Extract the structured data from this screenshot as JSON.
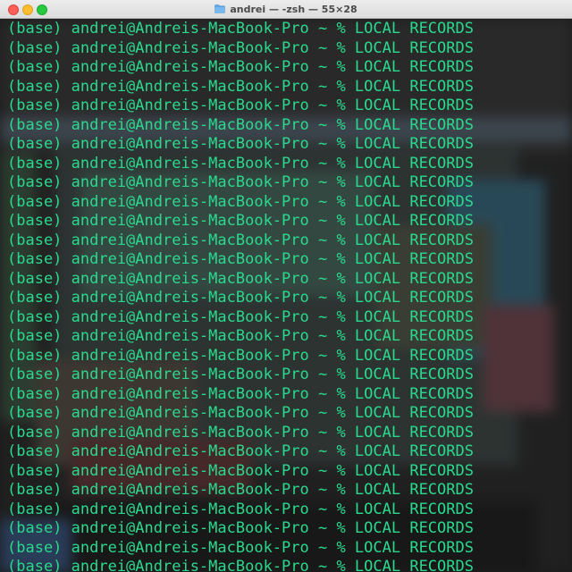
{
  "window": {
    "title": "andrei — -zsh — 55×28",
    "folder_icon": "folder-icon",
    "traffic_lights": {
      "close": "#fe5f57",
      "minimize": "#febc2e",
      "maximize": "#28c840"
    }
  },
  "colors": {
    "prompt_text": "#2bd98e",
    "terminal_bg": "#232323"
  },
  "terminal": {
    "lines": [
      "(base) andrei@Andreis-MacBook-Pro ~ % LOCAL RECORDS",
      "(base) andrei@Andreis-MacBook-Pro ~ % LOCAL RECORDS",
      "(base) andrei@Andreis-MacBook-Pro ~ % LOCAL RECORDS",
      "(base) andrei@Andreis-MacBook-Pro ~ % LOCAL RECORDS",
      "(base) andrei@Andreis-MacBook-Pro ~ % LOCAL RECORDS",
      "(base) andrei@Andreis-MacBook-Pro ~ % LOCAL RECORDS",
      "(base) andrei@Andreis-MacBook-Pro ~ % LOCAL RECORDS",
      "(base) andrei@Andreis-MacBook-Pro ~ % LOCAL RECORDS",
      "(base) andrei@Andreis-MacBook-Pro ~ % LOCAL RECORDS",
      "(base) andrei@Andreis-MacBook-Pro ~ % LOCAL RECORDS",
      "(base) andrei@Andreis-MacBook-Pro ~ % LOCAL RECORDS",
      "(base) andrei@Andreis-MacBook-Pro ~ % LOCAL RECORDS",
      "(base) andrei@Andreis-MacBook-Pro ~ % LOCAL RECORDS",
      "(base) andrei@Andreis-MacBook-Pro ~ % LOCAL RECORDS",
      "(base) andrei@Andreis-MacBook-Pro ~ % LOCAL RECORDS",
      "(base) andrei@Andreis-MacBook-Pro ~ % LOCAL RECORDS",
      "(base) andrei@Andreis-MacBook-Pro ~ % LOCAL RECORDS",
      "(base) andrei@Andreis-MacBook-Pro ~ % LOCAL RECORDS",
      "(base) andrei@Andreis-MacBook-Pro ~ % LOCAL RECORDS",
      "(base) andrei@Andreis-MacBook-Pro ~ % LOCAL RECORDS",
      "(base) andrei@Andreis-MacBook-Pro ~ % LOCAL RECORDS",
      "(base) andrei@Andreis-MacBook-Pro ~ % LOCAL RECORDS",
      "(base) andrei@Andreis-MacBook-Pro ~ % LOCAL RECORDS",
      "(base) andrei@Andreis-MacBook-Pro ~ % LOCAL RECORDS",
      "(base) andrei@Andreis-MacBook-Pro ~ % LOCAL RECORDS",
      "(base) andrei@Andreis-MacBook-Pro ~ % LOCAL RECORDS",
      "(base) andrei@Andreis-MacBook-Pro ~ % LOCAL RECORDS",
      "(base) andrei@Andreis-MacBook-Pro ~ % LOCAL RECORDS",
      "(base) andrei@Andreis-MacBook-Pro ~ % LOCAL RECORDS"
    ]
  }
}
